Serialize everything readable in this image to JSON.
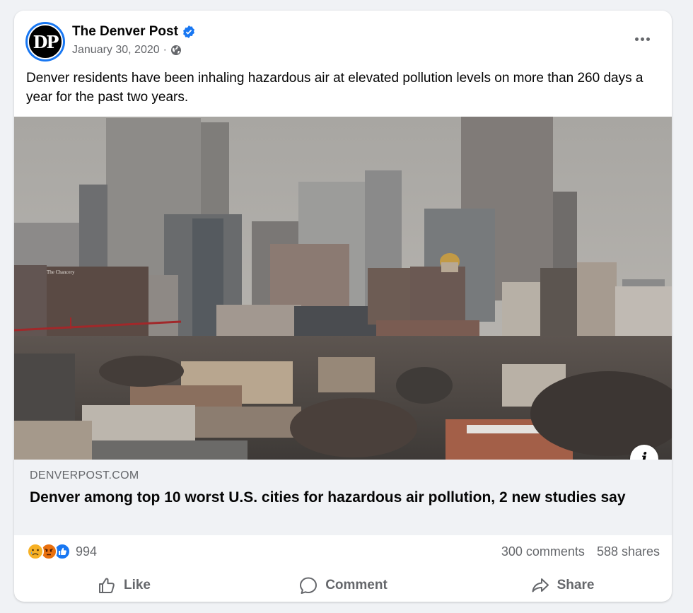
{
  "post": {
    "page_name": "The Denver Post",
    "avatar_text": "DP",
    "date": "January 30, 2020",
    "separator": "·",
    "text": "Denver residents have been inhaling hazardous air at elevated pollution levels on more than 260 days a year for the past two years."
  },
  "photo": {
    "sign_text": "The Chancery"
  },
  "link": {
    "domain": "DENVERPOST.COM",
    "title": "Denver among top 10 worst U.S. cities for hazardous air pollution, 2 new studies say",
    "info_glyph": "i"
  },
  "stats": {
    "reaction_icons": [
      "sad-reaction-icon",
      "angry-reaction-icon",
      "like-reaction-icon"
    ],
    "reaction_count": "994",
    "comments": "300 comments",
    "shares": "588 shares"
  },
  "actions": {
    "like": "Like",
    "comment": "Comment",
    "share": "Share"
  },
  "colors": {
    "brand_blue": "#1877f2",
    "secondary_text": "#65676b",
    "link_bg": "#f0f2f5"
  }
}
